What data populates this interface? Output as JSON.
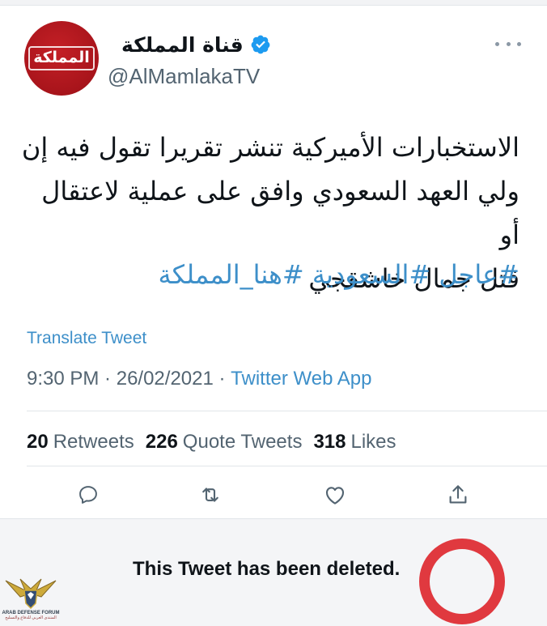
{
  "tweet": {
    "display_name": "قناة المملكة",
    "handle": "@AlMamlakaTV",
    "avatar_logo_text": "المملكة",
    "text_lines": [
      "الاستخبارات الأميركية تنشر تقريرا تقول فيه إن",
      "ولي العهد السعودي وافق على عملية لاعتقال أو",
      "قتل جمال خاشقجي"
    ],
    "hashtags": "#عاجل #السعودية #هنا_المملكة",
    "translate_label": "Translate Tweet",
    "time": "9:30 PM",
    "date": "26/02/2021",
    "separator": " · ",
    "source": "Twitter Web App",
    "stats": {
      "retweets_count": "20",
      "retweets_label": "Retweets",
      "quotes_count": "226",
      "quotes_label": "Quote Tweets",
      "likes_count": "318",
      "likes_label": "Likes"
    }
  },
  "actions": [
    "reply-icon",
    "retweet-icon",
    "like-icon",
    "share-icon"
  ],
  "deleted_notice": "This Tweet has been deleted.",
  "watermark": {
    "title": "ARAB DEFENSE FORUM",
    "subtitle": "المنتدى العربي للدفاع والتسليح"
  },
  "colors": {
    "link": "#3d8fc9",
    "muted": "#536471",
    "brand_red": "#b0161d",
    "highlight": "#e0393f"
  }
}
